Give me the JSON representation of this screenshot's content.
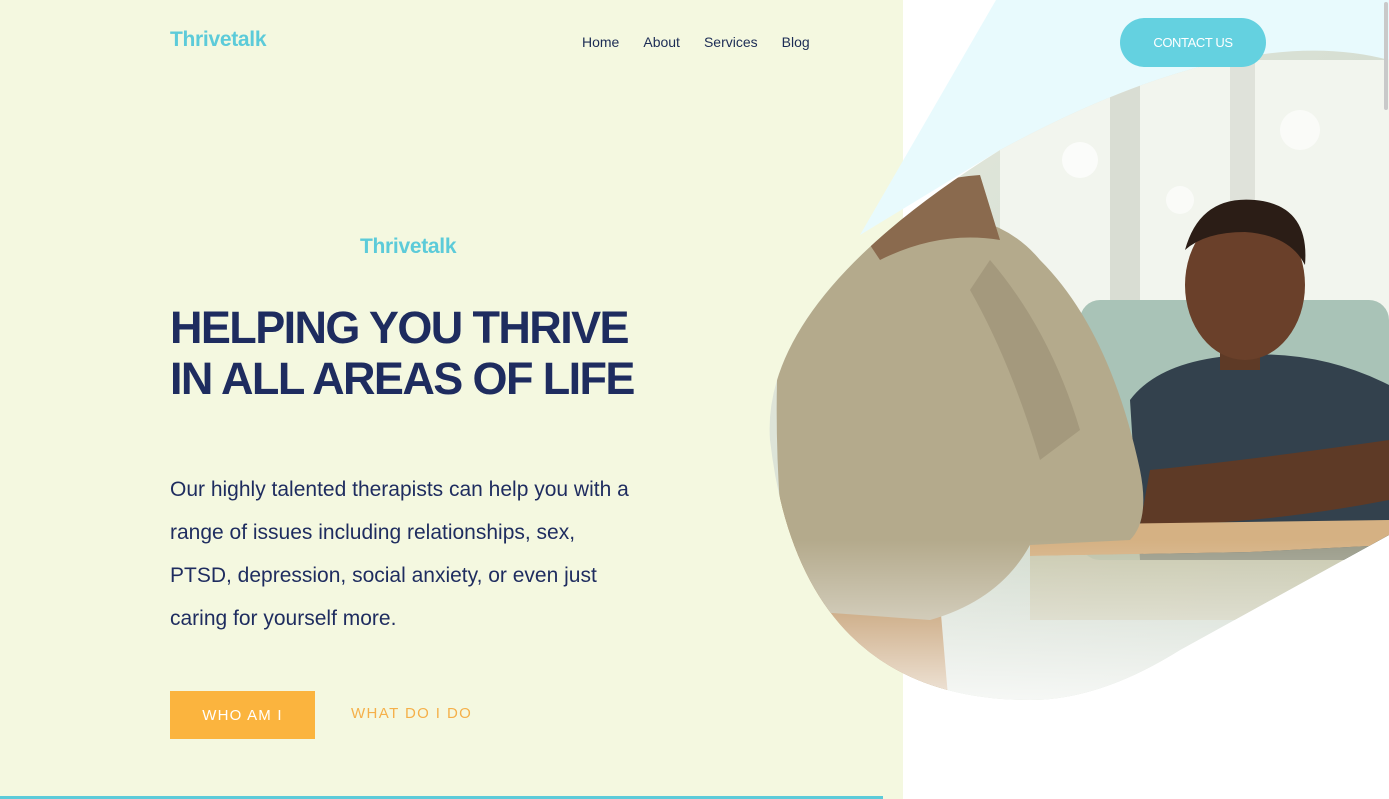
{
  "header": {
    "logo": "Thrivetalk",
    "nav": [
      {
        "label": "Home"
      },
      {
        "label": "About"
      },
      {
        "label": "Services"
      },
      {
        "label": "Blog"
      }
    ],
    "contact_label": "CONTACT US"
  },
  "hero": {
    "eyebrow": "Thrivetalk",
    "headline_line1": "HELPING YOU THRIVE",
    "headline_line2": "IN ALL AREAS OF LIFE",
    "body": "Our highly talented therapists can help you with a range of issues including relationships, sex, PTSD, depression, social anxiety, or even just caring for yourself more.",
    "primary_cta": "WHO AM I",
    "secondary_cta": "WHAT DO I DO",
    "image": "two-people-in-therapy-session-photo"
  },
  "colors": {
    "accent": "#5ccbd9",
    "navy": "#1e2c5f",
    "orange": "#fbb43e",
    "panel": "#f4f8e0"
  }
}
